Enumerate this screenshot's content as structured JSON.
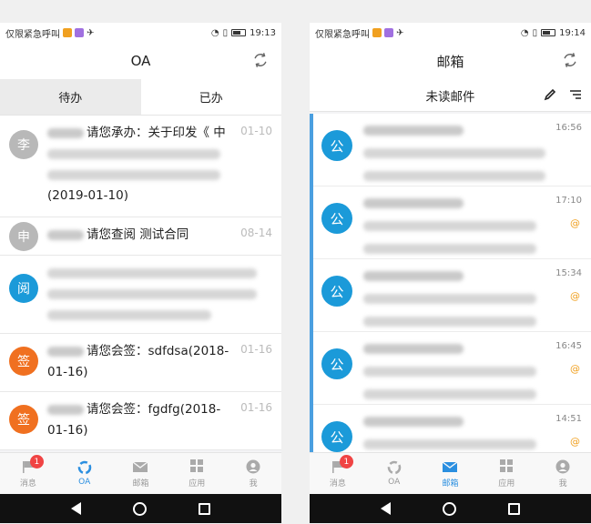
{
  "left": {
    "status": {
      "carrier": "仅限紧急呼叫",
      "time": "19:13"
    },
    "title": "OA",
    "tabs": [
      {
        "label": "待办"
      },
      {
        "label": "已办"
      }
    ],
    "items": [
      {
        "avatar": "李",
        "color": "#b8b8b8",
        "text": "请您承办：关于印发《 中",
        "text2": "(2019-01-10)",
        "date": "01-10"
      },
      {
        "avatar": "申",
        "color": "#b8b8b8",
        "text": "请您查阅 测试合同",
        "date": "08-14"
      },
      {
        "avatar": "阅",
        "color": "#1b9ad9",
        "text": "",
        "date": ""
      },
      {
        "avatar": "签",
        "color": "#f07020",
        "text": "请您会签：sdfdsa(2018-",
        "text2": "01-16)",
        "date": "01-16"
      },
      {
        "avatar": "签",
        "color": "#f07020",
        "text": "请您会签：fgdfg(2018-",
        "text2": "01-16)",
        "date": "01-16"
      }
    ],
    "tabbar": [
      {
        "label": "消息",
        "badge": "1"
      },
      {
        "label": "OA"
      },
      {
        "label": "邮箱"
      },
      {
        "label": "应用"
      },
      {
        "label": "我"
      }
    ]
  },
  "right": {
    "status": {
      "carrier": "仅限紧急呼叫",
      "time": "19:14"
    },
    "title": "邮箱",
    "mail_header": "未读邮件",
    "mails": [
      {
        "avatar": "公",
        "time": "16:56"
      },
      {
        "avatar": "公",
        "time": "17:10"
      },
      {
        "avatar": "公",
        "time": "15:34"
      },
      {
        "avatar": "公",
        "time": "16:45"
      },
      {
        "avatar": "公",
        "time": "14:51"
      }
    ],
    "tabbar": [
      {
        "label": "消息",
        "badge": "1"
      },
      {
        "label": "OA"
      },
      {
        "label": "邮箱"
      },
      {
        "label": "应用"
      },
      {
        "label": "我"
      }
    ]
  }
}
